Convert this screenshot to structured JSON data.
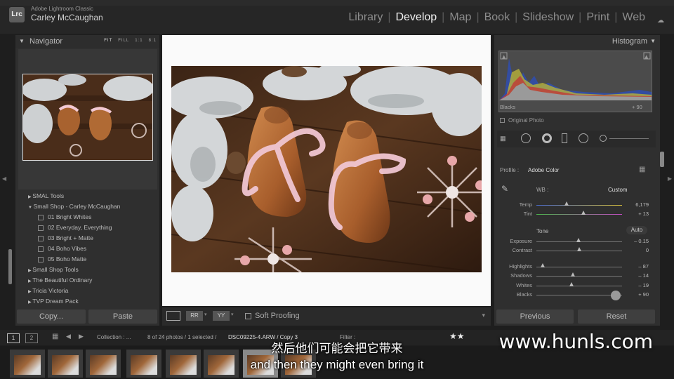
{
  "app": {
    "name": "Adobe Lightroom Classic",
    "logo": "Lrc",
    "user": "Carley McCaughan"
  },
  "modules": [
    "Library",
    "Develop",
    "Map",
    "Book",
    "Slideshow",
    "Print",
    "Web"
  ],
  "active_module": "Develop",
  "navigator": {
    "title": "Navigator",
    "zoom": [
      "FIT",
      "FILL",
      "1:1",
      "8:1"
    ]
  },
  "presets": {
    "items": [
      {
        "label": "SMAL Tools",
        "level": 0
      },
      {
        "label": "Small Shop - Carley McCaughan",
        "level": 0,
        "open": true
      },
      {
        "label": "01 Bright Whites",
        "level": 1
      },
      {
        "label": "02 Everyday, Everything",
        "level": 1
      },
      {
        "label": "03 Bright + Matte",
        "level": 1
      },
      {
        "label": "04 Boho Vibes",
        "level": 1
      },
      {
        "label": "05 Boho Matte",
        "level": 1
      },
      {
        "label": "Small Shop Tools",
        "level": 0
      },
      {
        "label": "The Beautiful Ordinary",
        "level": 0
      },
      {
        "label": "Tricia Victoria",
        "level": 0
      },
      {
        "label": "TVP Dream Pack",
        "level": 0
      }
    ]
  },
  "buttons": {
    "copy": "Copy...",
    "paste": "Paste",
    "previous": "Previous",
    "reset": "Reset"
  },
  "toolbar": {
    "soft_proofing": "Soft Proofing"
  },
  "histogram": {
    "title": "Histogram",
    "readout_label": "Blacks",
    "readout_value": "+ 90",
    "original_photo": "Original Photo"
  },
  "basic": {
    "profile_label": "Profile :",
    "profile_value": "Adobe Color",
    "wb_label": "WB :",
    "wb_value": "Custom",
    "tone_label": "Tone",
    "auto_label": "Auto",
    "sliders": [
      {
        "label": "Temp",
        "value": "6,179",
        "pos": 0.35
      },
      {
        "label": "Tint",
        "value": "+ 13",
        "pos": 0.55
      },
      {
        "label": "Exposure",
        "value": "– 0.15",
        "pos": 0.49
      },
      {
        "label": "Contrast",
        "value": "0",
        "pos": 0.5
      },
      {
        "label": "Highlights",
        "value": "– 87",
        "pos": 0.07
      },
      {
        "label": "Shadows",
        "value": "– 14",
        "pos": 0.43
      },
      {
        "label": "Whites",
        "value": "– 19",
        "pos": 0.41
      },
      {
        "label": "Blacks",
        "value": "+ 90",
        "pos": 0.95
      }
    ]
  },
  "filmstrip": {
    "pages": [
      "1",
      "2"
    ],
    "collection": "Collection : ...",
    "count": "8 of 24 photos / 1 selected /",
    "filename": "DSC09225-4.ARW / Copy 3",
    "filter_label": "Filter :"
  },
  "subtitles": {
    "zh": "然后他们可能会把它带来",
    "en": "and then they might even bring it"
  },
  "watermark": "www.hunls.com",
  "colors": {
    "accent": "#f2f2f2",
    "panel": "#2f2f2f",
    "background": "#1e1e1e"
  }
}
